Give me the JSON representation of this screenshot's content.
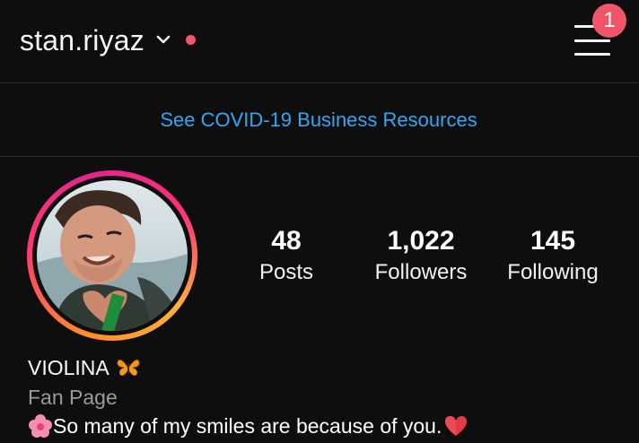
{
  "header": {
    "username": "stan.riyaz",
    "notification_count": "1",
    "icons": {
      "chevron": "chevron-down-icon",
      "live_dot": "status-dot",
      "menu": "hamburger-menu-icon"
    },
    "colors": {
      "dot": "#f0576a",
      "badge": "#f0556a"
    }
  },
  "banner": {
    "link_text": "See COVID-19 Business Resources",
    "color": "#2fa8f5"
  },
  "profile": {
    "avatar": "profile-photo",
    "ring_colors": [
      "#ff8b2b",
      "#ff3c6e",
      "#e1268f",
      "#ffb03a"
    ],
    "stats": {
      "posts": {
        "value": "48",
        "label": "Posts"
      },
      "followers": {
        "value": "1,022",
        "label": "Followers"
      },
      "following": {
        "value": "145",
        "label": "Following"
      }
    },
    "name": "VIOLINA",
    "name_emoji": "butterfly-icon",
    "category": "Fan Page",
    "bio_before": "So many of my smiles are because of you.",
    "bio_emojis": [
      "flower-icon",
      "heart-icon"
    ]
  }
}
